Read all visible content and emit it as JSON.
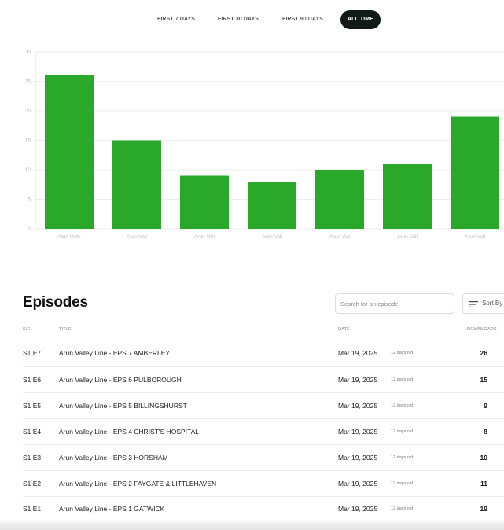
{
  "range_tabs": [
    {
      "label": "FIRST 7 DAYS",
      "active": false
    },
    {
      "label": "FIRST 30 DAYS",
      "active": false
    },
    {
      "label": "FIRST 90 DAYS",
      "active": false
    },
    {
      "label": "ALL TIME",
      "active": true
    }
  ],
  "colors": {
    "bar": "#29a829",
    "active_tab": "#111a17",
    "gridline": "#eeeeee",
    "axis_text": "#b8b8b8"
  },
  "chart_data": {
    "type": "bar",
    "categories": [
      "Arun Valle",
      "Arun Vall",
      "Arun Vall",
      "Arun Vall",
      "Arun Vall",
      "Arun Vall",
      "Arun Vall"
    ],
    "values": [
      26,
      15,
      9,
      8,
      10,
      11,
      19
    ],
    "yticks": [
      "0",
      "5",
      "10",
      "15",
      "20",
      "25",
      "30"
    ],
    "ylim": [
      0,
      30
    ],
    "grid": true
  },
  "episodes": {
    "title": "Episodes",
    "search_placeholder": "Search for an episode",
    "search_icon": "none",
    "sort_label": "Sort By",
    "sort_icon": "sort-lines-icon",
    "columns": {
      "se": "S/E",
      "title": "TITLE",
      "date": "DATE",
      "downloads": "DOWNLOADS"
    },
    "rows": [
      {
        "se": "S1 E7",
        "title": "Arun Valley Line - EPS 7 AMBERLEY",
        "date": "Mar 19, 2025",
        "age": "12 days old",
        "downloads": "26"
      },
      {
        "se": "S1 E6",
        "title": "Arun Valley Line - EPS 6 PULBOROUGH",
        "date": "Mar 19, 2025",
        "age": "12 days old",
        "downloads": "15"
      },
      {
        "se": "S1 E5",
        "title": "Arun Valley Line - EPS 5 BILLINGSHURST",
        "date": "Mar 19, 2025",
        "age": "12 days old",
        "downloads": "9"
      },
      {
        "se": "S1 E4",
        "title": "Arun Valley Line - EPS 4 CHRIST'S HOSPITAL",
        "date": "Mar 19, 2025",
        "age": "12 days old",
        "downloads": "8"
      },
      {
        "se": "S1 E3",
        "title": "Arun Valley Line - EPS 3 HORSHAM",
        "date": "Mar 19, 2025",
        "age": "12 days old",
        "downloads": "10"
      },
      {
        "se": "S1 E2",
        "title": "Arun Valley Line - EPS 2 FAYGATE & LITTLEHAVEN",
        "date": "Mar 19, 2025",
        "age": "12 days old",
        "downloads": "11"
      },
      {
        "se": "S1 E1",
        "title": "Arun Valley Line - EPS 1 GATWICK",
        "date": "Mar 19, 2025",
        "age": "12 days old",
        "downloads": "19"
      }
    ]
  }
}
